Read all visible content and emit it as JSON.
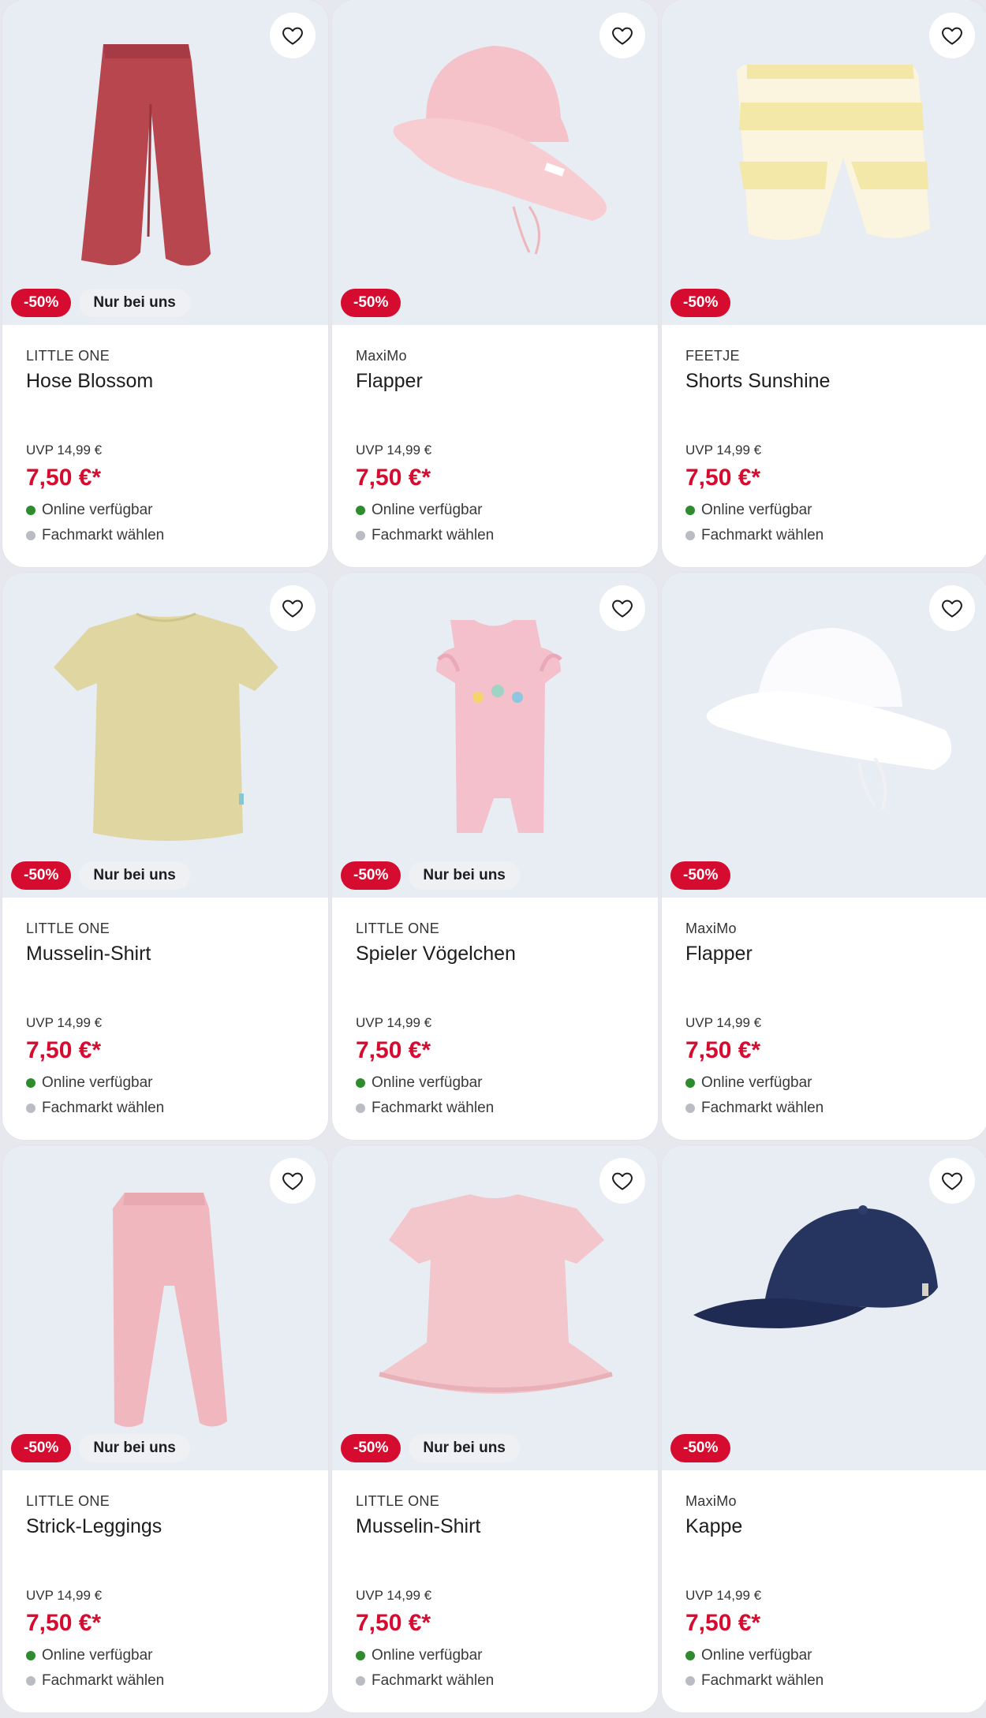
{
  "colors": {
    "accent_red": "#d50c2f",
    "online_green": "#2e8b2e",
    "store_grey": "#b9bcc3",
    "image_bg": "#e8ecf3"
  },
  "products": [
    {
      "brand": "LITTLE ONE",
      "name": "Hose Blossom",
      "uvp": "UVP 14,99 €",
      "price": "7,50 €*",
      "discount": "-50%",
      "exclusive": "Nur bei uns",
      "online": "Online verfügbar",
      "store": "Fachmarkt wählen",
      "favorite_icon": "heart-icon",
      "image": "pants-red"
    },
    {
      "brand": "MaxiMo",
      "name": "Flapper",
      "uvp": "UVP 14,99 €",
      "price": "7,50 €*",
      "discount": "-50%",
      "exclusive": "",
      "online": "Online verfügbar",
      "store": "Fachmarkt wählen",
      "favorite_icon": "heart-icon",
      "image": "hat-pink"
    },
    {
      "brand": "FEETJE",
      "name": "Shorts Sunshine",
      "uvp": "UVP 14,99 €",
      "price": "7,50 €*",
      "discount": "-50%",
      "exclusive": "",
      "online": "Online verfügbar",
      "store": "Fachmarkt wählen",
      "favorite_icon": "heart-icon",
      "image": "shorts-yellow"
    },
    {
      "brand": "LITTLE ONE",
      "name": "Musselin-Shirt",
      "uvp": "UVP 14,99 €",
      "price": "7,50 €*",
      "discount": "-50%",
      "exclusive": "Nur bei uns",
      "online": "Online verfügbar",
      "store": "Fachmarkt wählen",
      "favorite_icon": "heart-icon",
      "image": "shirt-olive"
    },
    {
      "brand": "LITTLE ONE",
      "name": "Spieler Vögelchen",
      "uvp": "UVP 14,99 €",
      "price": "7,50 €*",
      "discount": "-50%",
      "exclusive": "Nur bei uns",
      "online": "Online verfügbar",
      "store": "Fachmarkt wählen",
      "favorite_icon": "heart-icon",
      "image": "romper-pink"
    },
    {
      "brand": "MaxiMo",
      "name": "Flapper",
      "uvp": "UVP 14,99 €",
      "price": "7,50 €*",
      "discount": "-50%",
      "exclusive": "",
      "online": "Online verfügbar",
      "store": "Fachmarkt wählen",
      "favorite_icon": "heart-icon",
      "image": "hat-white"
    },
    {
      "brand": "LITTLE ONE",
      "name": "Strick-Leggings",
      "uvp": "UVP 14,99 €",
      "price": "7,50 €*",
      "discount": "-50%",
      "exclusive": "Nur bei uns",
      "online": "Online verfügbar",
      "store": "Fachmarkt wählen",
      "favorite_icon": "heart-icon",
      "image": "leggings-pink"
    },
    {
      "brand": "LITTLE ONE",
      "name": "Musselin-Shirt",
      "uvp": "UVP 14,99 €",
      "price": "7,50 €*",
      "discount": "-50%",
      "exclusive": "Nur bei uns",
      "online": "Online verfügbar",
      "store": "Fachmarkt wählen",
      "favorite_icon": "heart-icon",
      "image": "top-pink"
    },
    {
      "brand": "MaxiMo",
      "name": "Kappe",
      "uvp": "UVP 14,99 €",
      "price": "7,50 €*",
      "discount": "-50%",
      "exclusive": "",
      "online": "Online verfügbar",
      "store": "Fachmarkt wählen",
      "favorite_icon": "heart-icon",
      "image": "cap-navy"
    }
  ]
}
